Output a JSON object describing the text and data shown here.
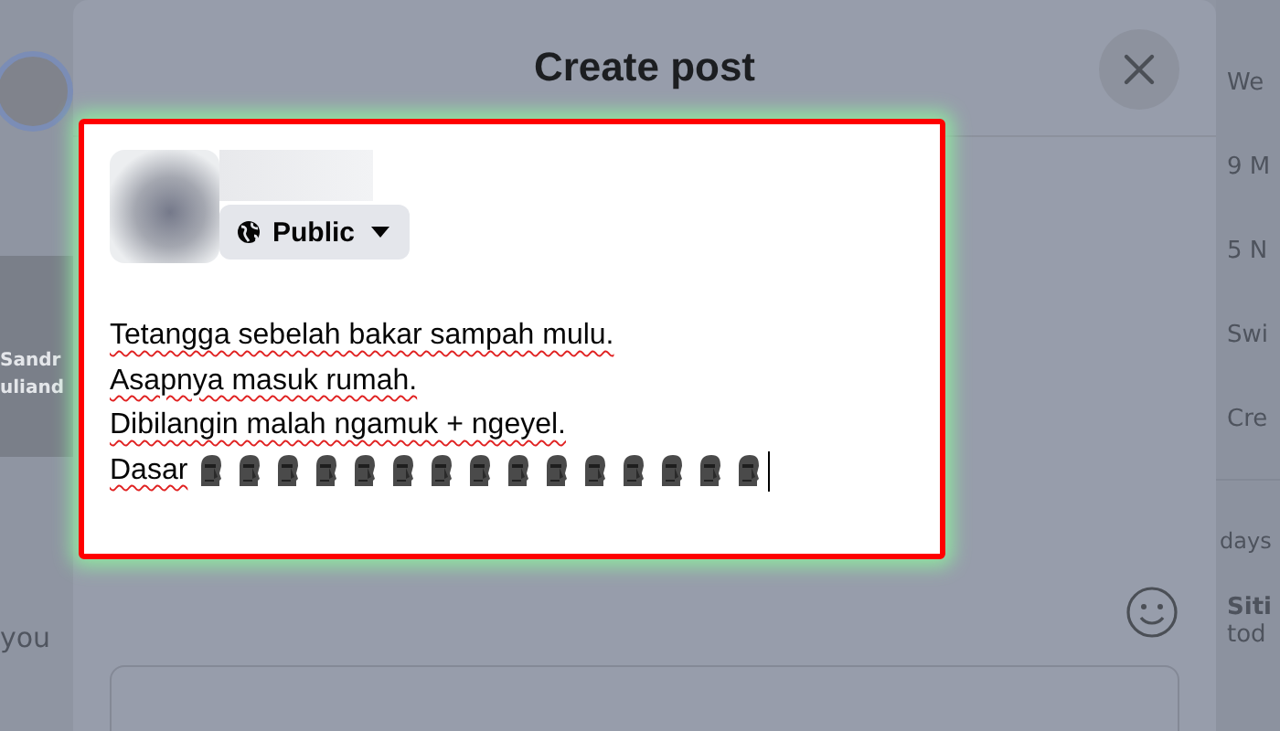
{
  "left_panel": {
    "story_name_lines": [
      "Sandr",
      "uliand"
    ],
    "prompt": "you"
  },
  "dialog": {
    "title": "Create post",
    "author": {
      "audience": "Public"
    },
    "post_lines": [
      {
        "text": "Tetangga sebelah bakar sampah mulu.",
        "misspelled": true
      },
      {
        "text": "Asapnya masuk rumah.",
        "misspelled": true
      },
      {
        "text": "Dibilangin malah ngamuk + ngeyel.",
        "misspelled": true
      },
      {
        "text": "Dasar",
        "misspelled": true,
        "icons": [
          {
            "kind": "moai"
          },
          {
            "kind": "moai"
          },
          {
            "kind": "moai"
          },
          {
            "kind": "moai"
          },
          {
            "kind": "moai"
          },
          {
            "kind": "moai"
          },
          {
            "kind": "moai"
          },
          {
            "kind": "moai"
          },
          {
            "kind": "moai"
          },
          {
            "kind": "moai"
          },
          {
            "kind": "moai"
          },
          {
            "kind": "moai"
          },
          {
            "kind": "moai"
          },
          {
            "kind": "moai"
          },
          {
            "kind": "moai"
          }
        ]
      }
    ]
  },
  "right_panel": {
    "items": [
      "We",
      "9 M",
      "5 N",
      "Swi",
      "Cre"
    ],
    "section": "days",
    "contact_lines": [
      "Siti",
      "tod"
    ]
  }
}
